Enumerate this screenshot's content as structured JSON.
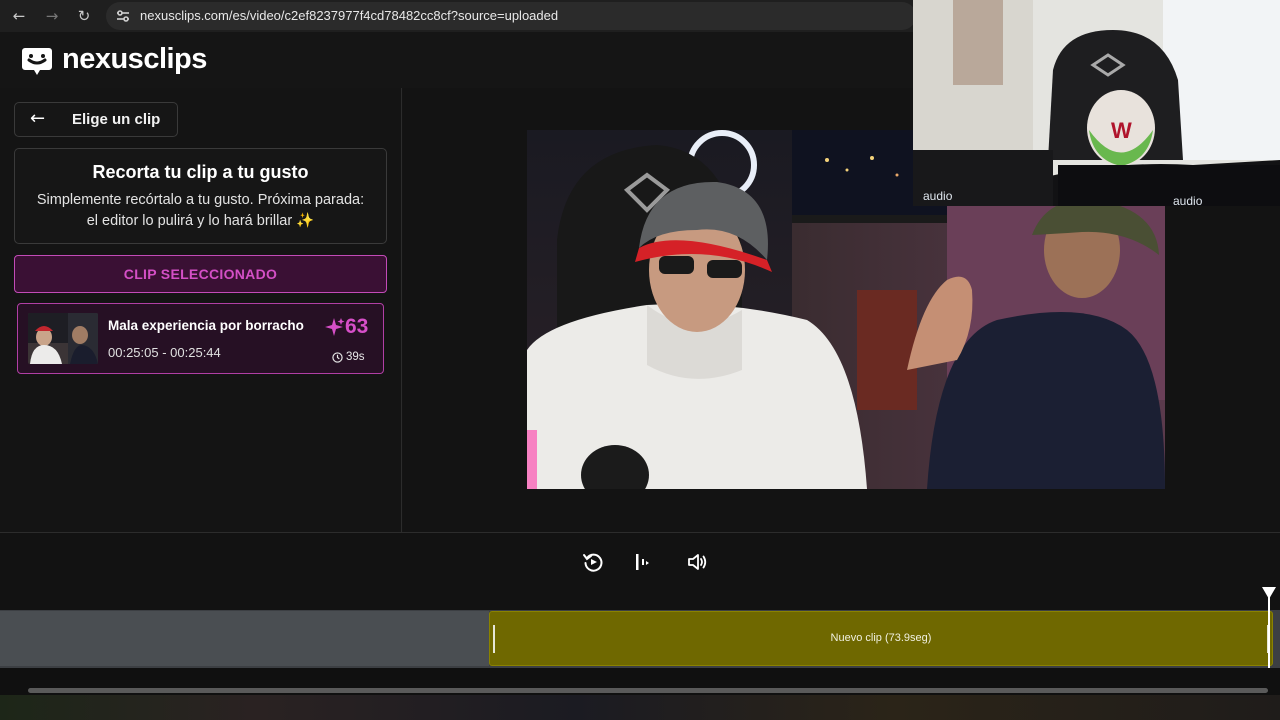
{
  "browser": {
    "url": "nexusclips.com/es/video/c2ef8237977f4cd78482cc8cf?source=uploaded",
    "back_icon": "arrow-left-icon",
    "forward_icon": "arrow-right-icon",
    "reload_icon": "reload-icon"
  },
  "app": {
    "brand": "nexusclips",
    "back_button_label": "Elige un clip",
    "info_card": {
      "title": "Recorta tu clip a tu gusto",
      "description": "Simplemente recórtalo a tu gusto. Próxima parada: el editor lo pulirá y lo hará brillar ✨"
    },
    "selected_label": "CLIP SELECCIONADO",
    "clip": {
      "title": "Mala experiencia por borracho",
      "time_range": "00:25:05 - 00:25:44",
      "score": "63",
      "duration": "39s"
    }
  },
  "controls": {
    "restart_icon": "restart-icon",
    "play_icon": "play-pause-icon",
    "volume_icon": "volume-icon"
  },
  "timeline": {
    "clip_label": "Nuevo clip (73.9seg)"
  },
  "colors": {
    "accent": "#d44fc6",
    "timeline_clip": "#6f6800",
    "background": "#141414"
  }
}
